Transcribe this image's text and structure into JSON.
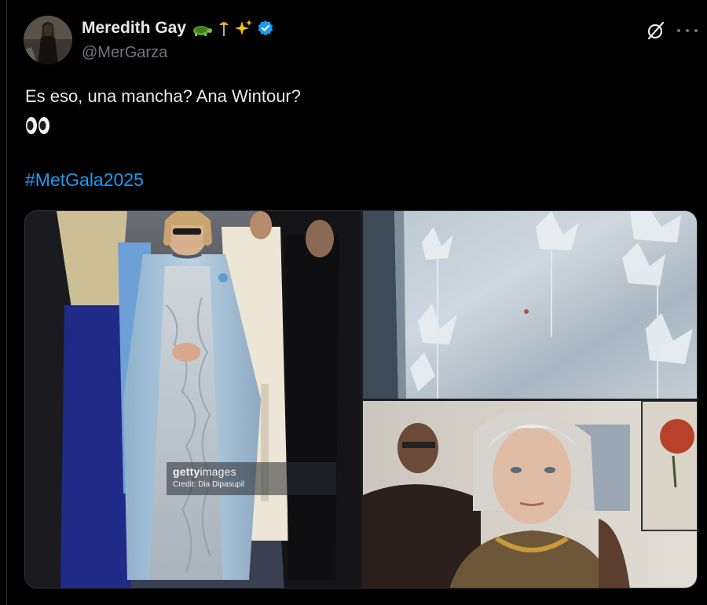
{
  "author": {
    "display_name": "Meredith Gay",
    "name_emojis": [
      "turtle-emoji",
      "beach-umbrella-emoji",
      "sparkles-emoji"
    ],
    "verified": true,
    "handle": "@MerGarza"
  },
  "tweet": {
    "text": "Es eso, una mancha? Ana Wintour?",
    "emoji": "eyes-emoji",
    "hashtag": "#MetGala2025"
  },
  "media": {
    "photos": [
      {
        "subject": "woman-in-pale-blue-coat-and-silver-embroidered-gown"
      },
      {
        "subject": "close-up-of-embroidered-satin-fabric"
      },
      {
        "subject": "movie-still-silver-haired-woman"
      }
    ],
    "watermark": {
      "logo_bold": "getty",
      "logo_light": "images",
      "credit": "Credit: Dia Dipasupil"
    }
  },
  "colors": {
    "background": "#000000",
    "text": "#e7e9ea",
    "secondary_text": "#71767b",
    "link": "#1d9bf0",
    "verified_badge": "#1d9bf0"
  }
}
